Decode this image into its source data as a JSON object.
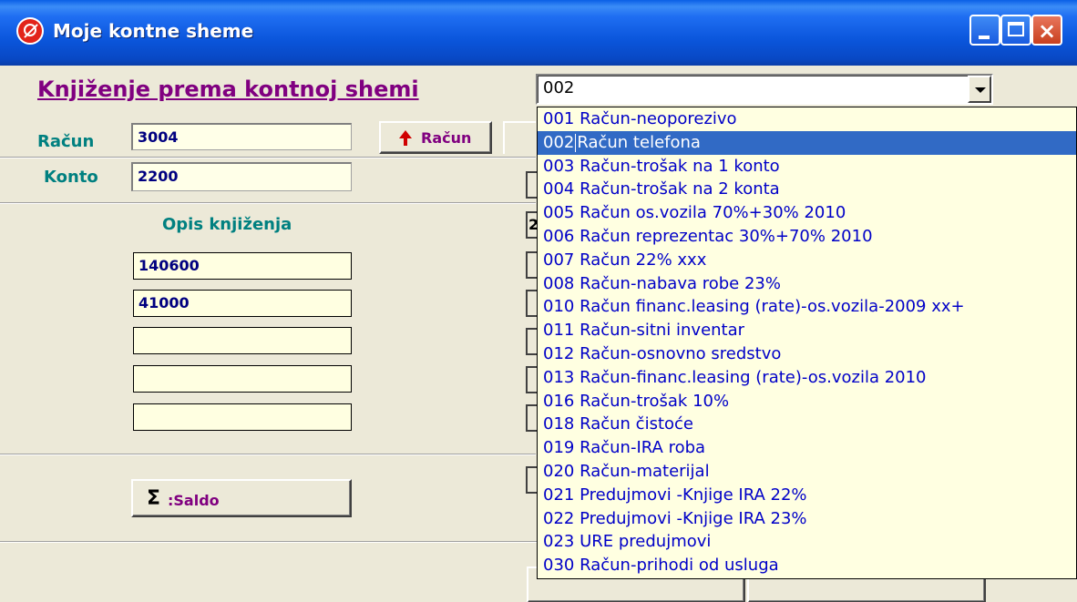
{
  "window": {
    "title": "Moje kontne sheme"
  },
  "heading": "Knjiženje prema kontnoj shemi",
  "racun": {
    "label": "Račun",
    "value": "3004"
  },
  "konto": {
    "label": "Konto",
    "value": "2200"
  },
  "racun_button": {
    "label": "Račun"
  },
  "opis": {
    "label": "Opis knjiženja",
    "fields": [
      "140600",
      "41000",
      "",
      "",
      ""
    ]
  },
  "saldo_button": {
    "label": ":Saldo",
    "symbol": "Σ"
  },
  "scheme_combo": {
    "value": "002",
    "options": [
      {
        "code": "001",
        "name": "Račun-neoporezivo"
      },
      {
        "code": "002",
        "name": "Račun telefona",
        "selected": true
      },
      {
        "code": "003",
        "name": "Račun-trošak na 1  konto"
      },
      {
        "code": "004",
        "name": "Račun-trošak na 2 konta"
      },
      {
        "code": "005",
        "name": "Račun os.vozila 70%+30% 2010"
      },
      {
        "code": "006",
        "name": "Račun reprezentac 30%+70%  2010"
      },
      {
        "code": "007",
        "name": "Račun 22% xxx"
      },
      {
        "code": "008",
        "name": "Račun-nabava robe 23%"
      },
      {
        "code": "010",
        "name": "Račun financ.leasing (rate)-os.vozila-2009 xx+"
      },
      {
        "code": "011",
        "name": "Račun-sitni inventar"
      },
      {
        "code": "012",
        "name": "Račun-osnovno sredstvo"
      },
      {
        "code": "013",
        "name": "Račun-financ.leasing (rate)-os.vozila 2010"
      },
      {
        "code": "016",
        "name": "Račun-trošak 10%"
      },
      {
        "code": "018",
        "name": "Račun čistoće"
      },
      {
        "code": "019",
        "name": "Račun-IRA roba"
      },
      {
        "code": "020",
        "name": "Račun-materijal"
      },
      {
        "code": "021",
        "name": "Predujmovi -Knjige IRA 22%"
      },
      {
        "code": "022",
        "name": "Predujmovi -Knjige IRA 23%"
      },
      {
        "code": "023",
        "name": "URE predujmovi"
      },
      {
        "code": "030",
        "name": "Račun-prihodi od usluga"
      }
    ]
  },
  "hidden_field_fragment": "2",
  "colors": {
    "titlebar": "#0a56dc",
    "form_bg": "#ece9d8",
    "field_bg": "#ffffe1",
    "heading": "#800080",
    "label": "#008080",
    "dropdown_text": "#0000c8",
    "selection": "#316ac5"
  }
}
